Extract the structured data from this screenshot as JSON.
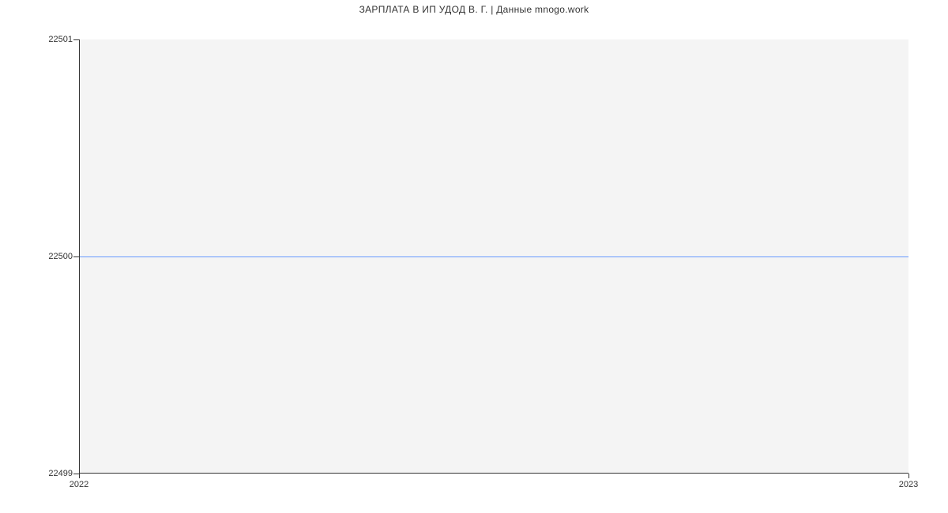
{
  "chart_data": {
    "type": "line",
    "title": "ЗАРПЛАТА В ИП УДОД В. Г. | Данные mnogo.work",
    "x": [
      "2022",
      "2023"
    ],
    "values": [
      22500,
      22500
    ],
    "xlabel": "",
    "ylabel": "",
    "y_ticks": [
      22499,
      22500,
      22501
    ],
    "x_ticks": [
      "2022",
      "2023"
    ],
    "ylim": [
      22499,
      22501
    ],
    "line_color": "#6699ff",
    "plot_bg": "#f4f4f4"
  }
}
